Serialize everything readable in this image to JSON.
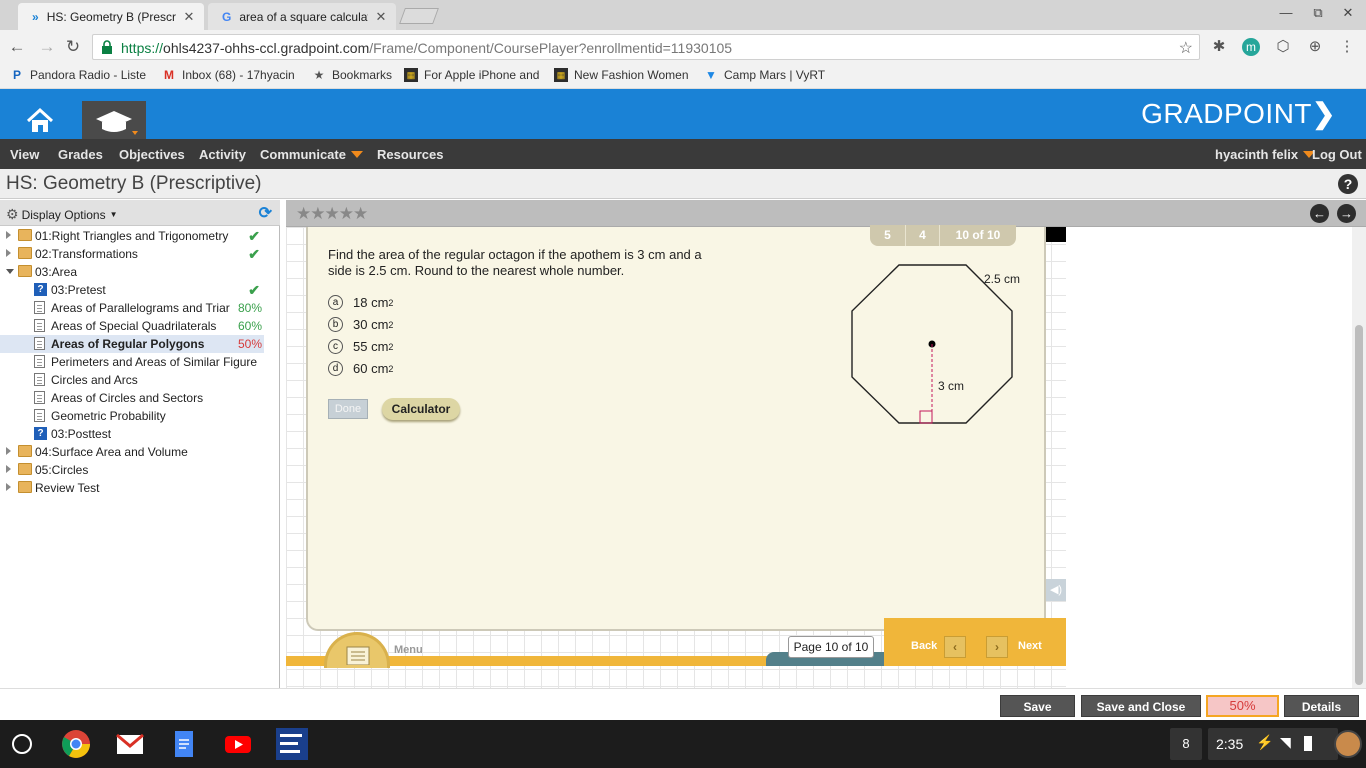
{
  "browser": {
    "tabs": [
      {
        "title": "HS: Geometry B (Prescrip",
        "active": true
      },
      {
        "title": "area of a square calculat",
        "active": false
      }
    ],
    "url_scheme": "https://",
    "url_host": "ohls4237-ohhs-ccl.gradpoint.com",
    "url_path": "/Frame/Component/CoursePlayer?enrollmentid=11930105",
    "bookmarks": [
      {
        "label": "Pandora Radio - Liste",
        "icon": "pandora-icon"
      },
      {
        "label": "Inbox (68) - 17hyacin",
        "icon": "gmail-icon"
      },
      {
        "label": "Bookmarks",
        "icon": "star-icon"
      },
      {
        "label": "For Apple iPhone and",
        "icon": "shop-icon"
      },
      {
        "label": "New Fashion Women",
        "icon": "shop-icon"
      },
      {
        "label": "Camp Mars | VyRT",
        "icon": "vyrt-icon"
      }
    ]
  },
  "app": {
    "logo": "GRADPOINT",
    "menu": [
      "View",
      "Grades",
      "Objectives",
      "Activity",
      "Communicate",
      "Resources"
    ],
    "user": "hyacinth felix",
    "logout": "Log Out",
    "course_title": "HS: Geometry B (Prescriptive)",
    "help": "?"
  },
  "sidebar": {
    "display_options": "Display Options",
    "items": [
      {
        "label": "01:Right Triangles and Trigonometry",
        "type": "folder",
        "level": 0,
        "expand": "right",
        "status": "check"
      },
      {
        "label": "02:Transformations",
        "type": "folder",
        "level": 0,
        "expand": "right",
        "status": "check"
      },
      {
        "label": "03:Area",
        "type": "folder",
        "level": 0,
        "expand": "down",
        "status": ""
      },
      {
        "label": "03:Pretest",
        "type": "quiz",
        "level": 1,
        "status": "check"
      },
      {
        "label": "Areas of Parallelograms and Triar",
        "type": "doc",
        "level": 1,
        "score": "80%",
        "score_color": "#3aa04c"
      },
      {
        "label": "Areas of Special Quadrilaterals",
        "type": "doc",
        "level": 1,
        "score": "60%",
        "score_color": "#3aa04c"
      },
      {
        "label": "Areas of Regular Polygons",
        "type": "doc",
        "level": 1,
        "score": "50%",
        "score_color": "#d63b3b",
        "selected": true
      },
      {
        "label": "Perimeters and Areas of Similar Figure",
        "type": "doc",
        "level": 1
      },
      {
        "label": "Circles and Arcs",
        "type": "doc",
        "level": 1
      },
      {
        "label": "Areas of Circles and Sectors",
        "type": "doc",
        "level": 1
      },
      {
        "label": "Geometric Probability",
        "type": "doc",
        "level": 1
      },
      {
        "label": "03:Posttest",
        "type": "quiz",
        "level": 1
      },
      {
        "label": "04:Surface Area and Volume",
        "type": "folder",
        "level": 0,
        "expand": "right"
      },
      {
        "label": "05:Circles",
        "type": "folder",
        "level": 0,
        "expand": "right"
      },
      {
        "label": "Review Test",
        "type": "folder",
        "level": 0,
        "expand": "right"
      }
    ]
  },
  "lesson": {
    "stars": "★★★★★",
    "question_nav": [
      "5",
      "4",
      "10 of 10"
    ],
    "question": "Find the area of the regular octagon if the apothem is 3 cm and a side is 2.5 cm. Round to the nearest whole number.",
    "choices": [
      {
        "letter": "a",
        "value": "18 cm",
        "sup": "2"
      },
      {
        "letter": "b",
        "value": "30 cm",
        "sup": "2"
      },
      {
        "letter": "c",
        "value": "55 cm",
        "sup": "2"
      },
      {
        "letter": "d",
        "value": "60 cm",
        "sup": "2"
      }
    ],
    "done": "Done",
    "calculator": "Calculator",
    "figure_side_label": "2.5 cm",
    "figure_apothem_label": "3 cm",
    "menu": "Menu",
    "page": "Page 10 of 10",
    "back": "Back",
    "next": "Next"
  },
  "actions": {
    "save": "Save",
    "save_close": "Save and Close",
    "percent": "50%",
    "details": "Details"
  },
  "shelf": {
    "notification_count": "8",
    "time": "2:35"
  }
}
